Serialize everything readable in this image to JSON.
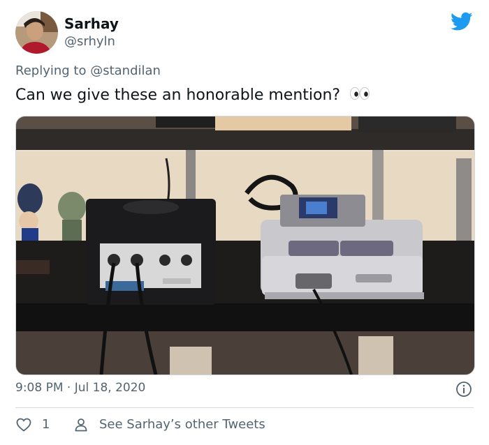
{
  "author": {
    "name": "Sarhay",
    "handle": "@srhyln"
  },
  "reply": {
    "prefix": "Replying to",
    "mention": "@standilan"
  },
  "tweet": {
    "text": "Can we give these an honorable mention?",
    "emoji_icon": "eyes-emoji"
  },
  "photo": {
    "icon": "photo-gamecube-and-snes-consoles"
  },
  "meta": {
    "timestamp": "9:08 PM · Jul 18, 2020"
  },
  "actions": {
    "like_count": "1",
    "other_tweets_label": "See Sarhay’s other Tweets"
  },
  "colors": {
    "brand_blue": "#1d9bf0",
    "secondary_text": "#536471",
    "border": "#cfd9de"
  }
}
